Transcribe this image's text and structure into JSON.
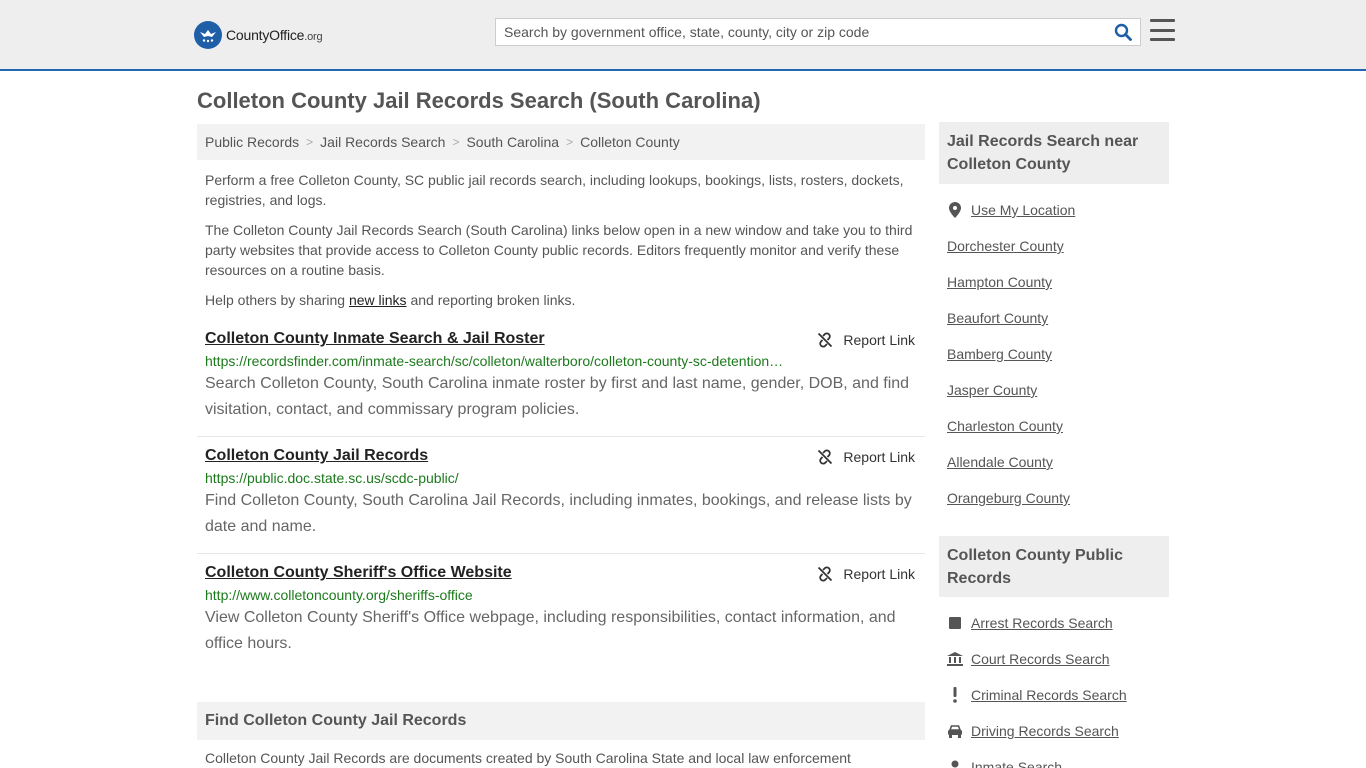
{
  "header": {
    "logo_main": "CountyOffice",
    "logo_tld": ".org",
    "search_placeholder": "Search by government office, state, county, city or zip code"
  },
  "page": {
    "title": "Colleton County Jail Records Search (South Carolina)"
  },
  "breadcrumb": [
    "Public Records",
    "Jail Records Search",
    "South Carolina",
    "Colleton County"
  ],
  "intro": {
    "p1": "Perform a free Colleton County, SC public jail records search, including lookups, bookings, lists, rosters, dockets, registries, and logs.",
    "p2": "The Colleton County Jail Records Search (South Carolina) links below open in a new window and take you to third party websites that provide access to Colleton County public records. Editors frequently monitor and verify these resources on a routine basis.",
    "p3_before": "Help others by sharing ",
    "p3_link": "new links",
    "p3_after": " and reporting broken links."
  },
  "report_label": "Report Link",
  "results": [
    {
      "title": "Colleton County Inmate Search & Jail Roster",
      "url": "https://recordsfinder.com/inmate-search/sc/colleton/walterboro/colleton-county-sc-detention-center/",
      "desc": "Search Colleton County, South Carolina inmate roster by first and last name, gender, DOB, and find visitation, contact, and commissary program policies."
    },
    {
      "title": "Colleton County Jail Records",
      "url": "https://public.doc.state.sc.us/scdc-public/",
      "desc": "Find Colleton County, South Carolina Jail Records, including inmates, bookings, and release lists by date and name."
    },
    {
      "title": "Colleton County Sheriff's Office Website",
      "url": "http://www.colletoncounty.org/sheriffs-office",
      "desc": "View Colleton County Sheriff's Office webpage, including responsibilities, contact information, and office hours."
    }
  ],
  "find_section": {
    "title": "Find Colleton County Jail Records",
    "text": "Colleton County Jail Records are documents created by South Carolina State and local law enforcement"
  },
  "sidebar": {
    "nearby_title": "Jail Records Search near Colleton County",
    "use_location": "Use My Location",
    "nearby": [
      "Dorchester County",
      "Hampton County",
      "Beaufort County",
      "Bamberg County",
      "Jasper County",
      "Charleston County",
      "Allendale County",
      "Orangeburg County"
    ],
    "public_title": "Colleton County Public Records",
    "public_links": [
      {
        "label": "Arrest Records Search",
        "icon": "square-icon"
      },
      {
        "label": "Court Records Search",
        "icon": "courthouse-icon"
      },
      {
        "label": "Criminal Records Search",
        "icon": "exclamation-icon"
      },
      {
        "label": "Driving Records Search",
        "icon": "car-icon"
      },
      {
        "label": "Inmate Search",
        "icon": "person-icon"
      }
    ]
  }
}
